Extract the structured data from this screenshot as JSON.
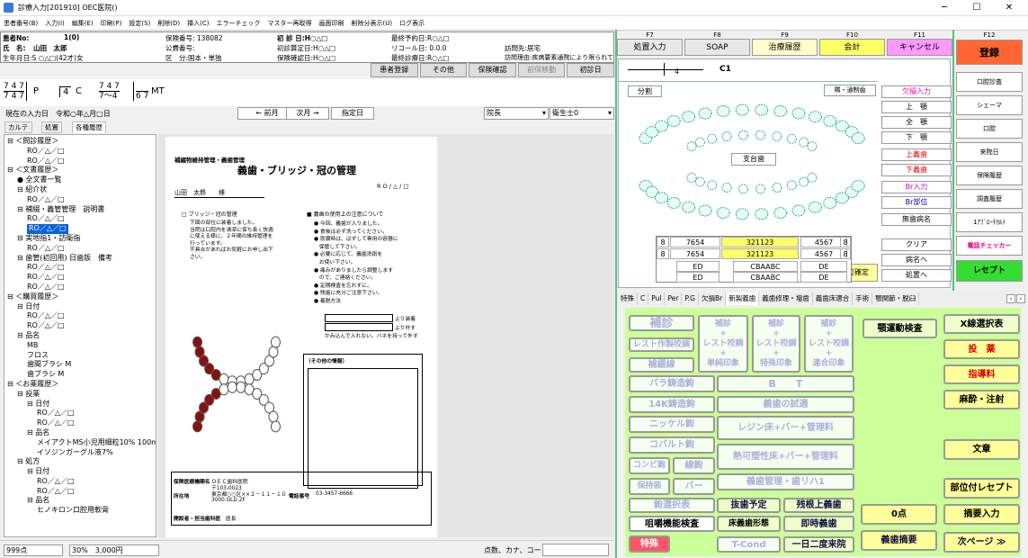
{
  "window": {
    "title": "診療入力[201910] OEC医院()",
    "controls": [
      "─",
      "☐",
      "✕"
    ]
  },
  "menu": [
    "患者番号(B)",
    "入力(I)",
    "編集(E)",
    "印刷(P)",
    "設定(S)",
    "削除(D)",
    "挿入(C)",
    "エラーチェック",
    "マスター再取得",
    "画面印刷",
    "削除分表示(U)",
    "ログ表示"
  ],
  "patient": {
    "no_label": "患者No:",
    "no": "1(0)",
    "name_label": "氏　名:",
    "name": "山田　太郎",
    "dob": "生年月日:S ○△□(42才)女",
    "ins_no": "保険番号: 138082",
    "pub_no": "公費番号:",
    "ku": "区　分:国本・単独",
    "first_visit": "初 診 日:H○△□",
    "first_calc": "初診算定日:H○△□",
    "ins_confirm": "保険確認日:H○△□",
    "last_appt": "最終予約日:R○△□",
    "recall": "リコール日: 0.0.0",
    "last_visit": "最終診療日:R○△□",
    "visit_dest": "訪問先:居宅",
    "visit_reason": "訪問理由:疾病要素通院により限られている"
  },
  "patient_buttons": [
    {
      "label": "患者登録",
      "disabled": false
    },
    {
      "label": "その他",
      "disabled": false
    },
    {
      "label": "保険確認",
      "disabled": false
    },
    {
      "label": "前保移動",
      "disabled": true
    },
    {
      "label": "初診日",
      "disabled": false
    }
  ],
  "formula": {
    "a": "7 4 7",
    "b": "7 4 7",
    "p": "P",
    "c_num": "4",
    "c": "C",
    "m1": "7 4 7",
    "m2": "7～4",
    "m3": "6 7",
    "mt": "MT"
  },
  "nav": {
    "current": "現在の入力日　令和○年△月□日",
    "prev": "← 前月",
    "next": "次月 →",
    "specify": "指定日",
    "doctor": "院長",
    "hygienist": "衛生士0"
  },
  "tabs": [
    "カルテ",
    "処置",
    "各種履歴"
  ],
  "tree": [
    {
      "t": "⊟ ＜問診履歴＞",
      "i": 0
    },
    {
      "t": "RO／△／□",
      "i": 2
    },
    {
      "t": "RO／△／□",
      "i": 2
    },
    {
      "t": "⊟ ＜文書履歴＞",
      "i": 0
    },
    {
      "t": "● 全文書一覧",
      "i": 1
    },
    {
      "t": "⊟ 紹介状",
      "i": 1
    },
    {
      "t": "RO／△／□",
      "i": 2
    },
    {
      "t": "⊟ 補綴・義管管理　説明書",
      "i": 1
    },
    {
      "t": "RO／△／□",
      "i": 2
    },
    {
      "t": "RO／△／□",
      "i": 2,
      "sel": true
    },
    {
      "t": "⊟ 実地指1・訪衛指",
      "i": 1
    },
    {
      "t": "RO／△／□",
      "i": 2
    },
    {
      "t": "⊟ 歯管(初回用) 日歯版　備考",
      "i": 1
    },
    {
      "t": "RO／△／□",
      "i": 2
    },
    {
      "t": "RO／△／□",
      "i": 2
    },
    {
      "t": "RO／△／□",
      "i": 2
    },
    {
      "t": "⊟ ＜購買履歴＞",
      "i": 0
    },
    {
      "t": "⊟ 日付",
      "i": 1
    },
    {
      "t": "RO／△／□",
      "i": 2
    },
    {
      "t": "RO／△／□",
      "i": 2
    },
    {
      "t": "⊟ 品名",
      "i": 1
    },
    {
      "t": "MB",
      "i": 2
    },
    {
      "t": "フロス",
      "i": 2
    },
    {
      "t": "歯間ブラシ M",
      "i": 2
    },
    {
      "t": "歯ブラシ M",
      "i": 2
    },
    {
      "t": "⊟ ＜お薬履歴＞",
      "i": 0
    },
    {
      "t": "⊟ 投薬",
      "i": 1
    },
    {
      "t": "⊟ 日付",
      "i": 2
    },
    {
      "t": "RO／△／□",
      "i": 3
    },
    {
      "t": "RO／△／□",
      "i": 3
    },
    {
      "t": "⊟ 品名",
      "i": 2
    },
    {
      "t": "メイアクトMS小児用細粒10% 100m",
      "i": 3
    },
    {
      "t": "イソジンガーグル液7%",
      "i": 3
    },
    {
      "t": "⊟ 処方",
      "i": 1
    },
    {
      "t": "⊟ 日付",
      "i": 2
    },
    {
      "t": "RO／△／□",
      "i": 3
    },
    {
      "t": "RO／△／□",
      "i": 3
    },
    {
      "t": "⊟ 品名",
      "i": 2
    },
    {
      "t": "ヒノキロン口腔用軟膏",
      "i": 3
    }
  ],
  "doc": {
    "hdr": "補綴物維持管理・義歯管理",
    "title": "義歯・ブリッジ・冠の管理",
    "date": "R O / △ / □",
    "patient": "山田　太郎　　様",
    "s1": "□ ブリッジ・冠の管理",
    "s1_text": [
      "下図の部位に装着しました。",
      "当院は口腔内を清潔に保ち長く快適",
      "に使える様に、２年間の維持管理を",
      "行っています。",
      "不具合があればお気軽にお申し出下",
      "さい。"
    ],
    "s2": "■ 義歯の使用上の注意について",
    "s2_items": [
      "今回、義歯が入りました。",
      "食後は必ず洗ってください。",
      "就寝時は、はずして専用の容器に",
      "保管して下さい。",
      "必要に応じて、義歯洗剤を",
      "お使い下さい。",
      "痛みがありましたら調整します",
      "ので、ご連絡ください。",
      "定期検査を忘れずに。",
      "残歯に充分ご注意下さい。",
      "着脱方法"
    ],
    "insert_label": "より装着",
    "remove_label": "より外す",
    "note": "かみ込んで入れない。バネを持って外す",
    "other": "（その他の情報）",
    "org_label": "保険医療機関名",
    "org": "ＯＥＣ歯科医院",
    "addr_label": "所在地",
    "addr": "〒103-0023\n東京都○○区××２－１１－１０\n3000 OLD 2F",
    "tel_label": "電話番号",
    "tel": "03-3457-6666",
    "dr_label": "開設者・担当歯科医",
    "dr": "医長"
  },
  "status": {
    "points": "999点",
    "ratio": "30%",
    "yen": "3,000円",
    "search": "点数、カナ、コード"
  },
  "fkeys": [
    {
      "k": "F7",
      "l": "処置入力",
      "bg": "#e8e8e8"
    },
    {
      "k": "F8",
      "l": "SOAP",
      "bg": "#e8e8e8"
    },
    {
      "k": "F9",
      "l": "治療履歴",
      "bg": "#ffffcc"
    },
    {
      "k": "F10",
      "l": "会計",
      "bg": "#ffff66"
    },
    {
      "k": "F11",
      "l": "キャンセル",
      "bg": "#ff99ff"
    }
  ],
  "f12": {
    "k": "F12",
    "l": "登録"
  },
  "dental": {
    "ruler": "4",
    "c1": "C1",
    "split": "分割",
    "partial": "隣・通制歯",
    "pillar": "支台歯",
    "confirm": "部位確定",
    "side": [
      "欠損入力",
      "上　顎",
      "全　顎",
      "下　顎",
      "上義歯",
      "下義歯",
      "Br入力",
      "Br部位",
      "無歯病名",
      "クリア",
      "病名へ",
      "処置へ"
    ],
    "grid": [
      [
        "8",
        "7654",
        "321123",
        "4567",
        "8"
      ],
      [
        "8",
        "7654",
        "321123",
        "4567",
        "8"
      ],
      [
        "ED",
        "CBAABC",
        "DE"
      ],
      [
        "ED",
        "CBAABC",
        "DE"
      ]
    ]
  },
  "right_col": [
    "口腔診査",
    "シェーマ",
    "口腔",
    "来院日",
    "保険履歴",
    "調査履歴",
    "1ｱﾌﾞﾛｰﾁｶﾙﾃ",
    "電話チェッカー",
    "レセプト"
  ],
  "rtabs": [
    "特殊",
    "C",
    "Pul",
    "Per",
    "P.G",
    "欠損Br",
    "新製義歯",
    "義歯修理・増歯",
    "義歯床適合",
    "手術",
    "顎関節・脱臼"
  ],
  "tpanel": {
    "hosetsu": "補診",
    "rest1": "レスト作製咬調",
    "rest2": "補診\n+\nレスト咬調\n+\n単純印象",
    "rest3": "補診\n+\nレスト咬調\n+\n特殊印象",
    "rest4": "補診\n+\nレスト咬調\n+\n連合印象",
    "hosetsu_sen": "補綴線",
    "bar": "バラ鋳造鉤",
    "bt": "B　　T",
    "k14": "14K鋳造鉤",
    "shiken": "義歯の試適",
    "nickel": "ニッケル鉤",
    "resin": "レジン床+バー+管理料",
    "cobalt": "コバルト鉤",
    "kaso": "熱可塑性床+バー+管理料",
    "combi": "コンビ鉤",
    "sen": "線鉤",
    "kanri": "義歯管理・歯リハ1",
    "hoji": "保持装",
    "bar2": "バー",
    "kyo": "鉤選択表",
    "bassi": "抜歯予定",
    "zan": "残根上義歯",
    "soshaku": "咀嚼機能検査",
    "tokei": "床義歯形態",
    "sokuji": "即時義歯",
    "tokushu": "特殊",
    "tcond": "T-Cond",
    "ichinichi": "一日二度来院",
    "gaku": "顎運動検査",
    "xsen": "X線選択表",
    "touyaku": "投　薬",
    "shido": "指導料",
    "masui": "麻酔・注射",
    "bunsho": "文章",
    "bui": "部位付レセプト",
    "zero": "0点",
    "tekiyo": "摘要入力",
    "gishi": "義歯摘要",
    "next": "次ページ ≫"
  }
}
